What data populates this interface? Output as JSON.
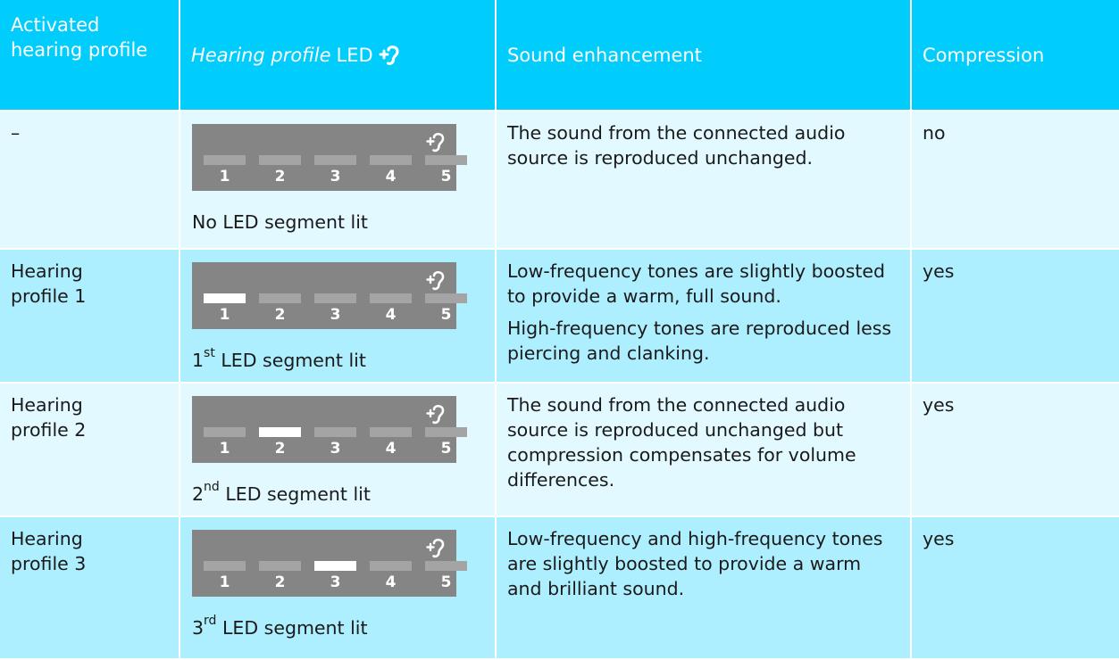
{
  "header": {
    "col1": "Activated hearing profile",
    "col2_italic": "Hearing profile",
    "col2_rest": "LED",
    "col2_icon": "hearing-profile-ear-icon",
    "col3": "Sound enhancement",
    "col4": "Compression"
  },
  "colors": {
    "header_bg": "#00cdfc",
    "row_light": "#e2f9ff",
    "row_dark": "#aeefff",
    "panel_bg": "#858585",
    "segment_off": "#a4a4a4",
    "segment_on": "#ffffff"
  },
  "led_numbers": [
    "1",
    "2",
    "3",
    "4",
    "5"
  ],
  "rows": [
    {
      "profile": "–",
      "lit_segment": 0,
      "caption_pre": "No LED segment lit",
      "caption_sup": "",
      "caption_post": "",
      "enhancement": [
        "The sound from the connected audio source is reproduced unchanged."
      ],
      "compression": "no"
    },
    {
      "profile": "Hearing profile 1",
      "lit_segment": 1,
      "caption_pre": "1",
      "caption_sup": "st",
      "caption_post": " LED segment lit",
      "enhancement": [
        "Low-frequency tones are slightly boosted to provide a warm, full sound.",
        "High-frequency tones are reproduced less piercing and clanking."
      ],
      "compression": "yes"
    },
    {
      "profile": "Hearing profile 2",
      "lit_segment": 2,
      "caption_pre": "2",
      "caption_sup": "nd",
      "caption_post": " LED segment lit",
      "enhancement": [
        "The sound from the connected audio source is reproduced unchanged but compression compensates for volume differences."
      ],
      "compression": "yes"
    },
    {
      "profile": "Hearing profile 3",
      "lit_segment": 3,
      "caption_pre": "3",
      "caption_sup": "rd",
      "caption_post": " LED segment lit",
      "enhancement": [
        "Low-frequency and high-frequency tones are slightly boosted to provide a warm and brilliant sound."
      ],
      "compression": "yes"
    }
  ]
}
